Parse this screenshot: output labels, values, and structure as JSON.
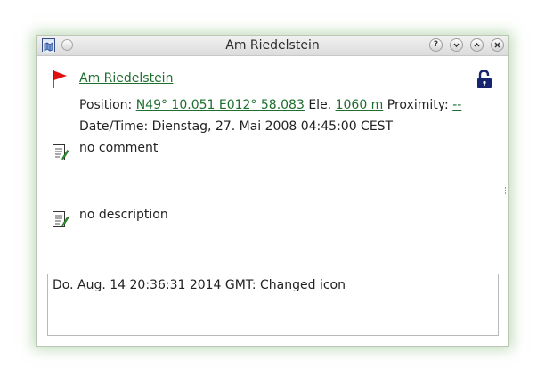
{
  "window": {
    "title": "Am Riedelstein",
    "buttons": {
      "help": "?",
      "minimize": "v",
      "maximize": "^",
      "close": "x"
    }
  },
  "waypoint": {
    "name": "Am Riedelstein",
    "position_label": "Position:",
    "position_value": "N49° 10.051 E012° 58.083",
    "elevation_label": "Ele.",
    "elevation_value": "1060 m",
    "proximity_label": "Proximity:",
    "proximity_value": "--",
    "datetime_label": "Date/Time:",
    "datetime_value": "Dienstag, 27. Mai 2008 04:45:00 CEST",
    "comment": "no comment",
    "description": "no description"
  },
  "log": {
    "entry": "Do. Aug. 14 20:36:31 2014 GMT: Changed icon"
  },
  "colors": {
    "link": "#1e6e2f",
    "flag": "#e11010",
    "lock": "#16236e",
    "window_glow": "#8cbe82"
  },
  "icons": {
    "flag": "red-flag-icon",
    "lock": "open-padlock-icon",
    "comment": "edit-note-icon",
    "description": "edit-note-icon"
  }
}
